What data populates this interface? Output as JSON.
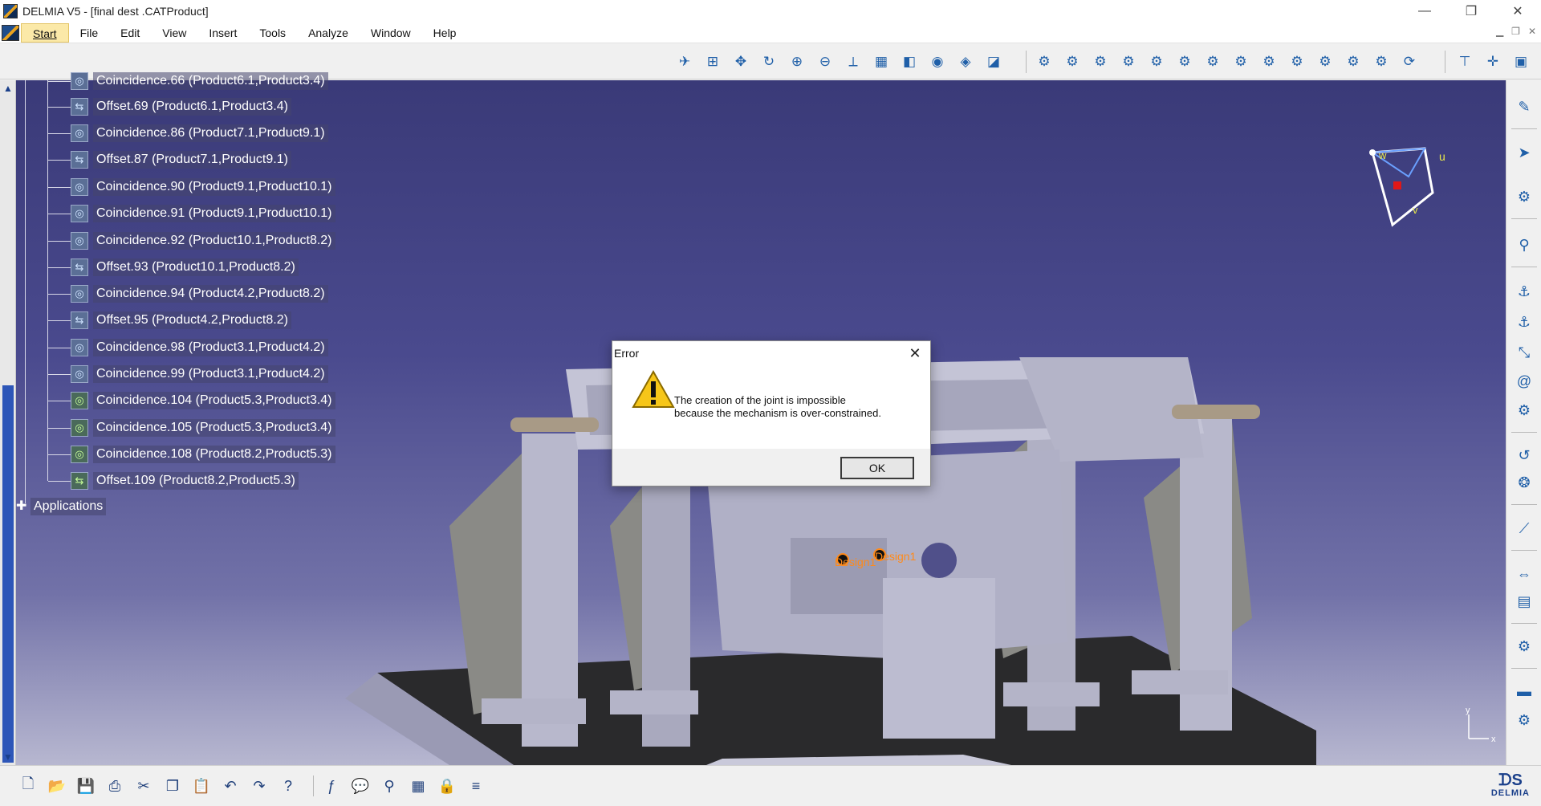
{
  "window": {
    "title": "DELMIA V5 - [final dest .CATProduct]",
    "minimize": "—",
    "restore": "❐",
    "close": "✕"
  },
  "menu": {
    "items": [
      {
        "label": "Start",
        "key": "start"
      },
      {
        "label": "File",
        "key": "file"
      },
      {
        "label": "Edit",
        "key": "edit"
      },
      {
        "label": "View",
        "key": "view"
      },
      {
        "label": "Insert",
        "key": "insert"
      },
      {
        "label": "Tools",
        "key": "tools"
      },
      {
        "label": "Analyze",
        "key": "analyze"
      },
      {
        "label": "Window",
        "key": "window"
      },
      {
        "label": "Help",
        "key": "help"
      }
    ]
  },
  "tree": {
    "partial_top": "Coincidence.66 (Product6.1,Product3.4)",
    "items": [
      {
        "label": "Offset.69 (Product6.1,Product3.4)",
        "icon": "offset-constraint-icon"
      },
      {
        "label": "Coincidence.86 (Product7.1,Product9.1)",
        "icon": "coincidence-constraint-icon"
      },
      {
        "label": "Offset.87 (Product7.1,Product9.1)",
        "icon": "offset-constraint-icon"
      },
      {
        "label": "Coincidence.90 (Product9.1,Product10.1)",
        "icon": "coincidence-constraint-icon"
      },
      {
        "label": "Coincidence.91 (Product9.1,Product10.1)",
        "icon": "coincidence-constraint-icon"
      },
      {
        "label": "Coincidence.92 (Product10.1,Product8.2)",
        "icon": "coincidence-constraint-icon"
      },
      {
        "label": "Offset.93 (Product10.1,Product8.2)",
        "icon": "offset-constraint-icon"
      },
      {
        "label": "Coincidence.94 (Product4.2,Product8.2)",
        "icon": "coincidence-constraint-icon"
      },
      {
        "label": "Offset.95 (Product4.2,Product8.2)",
        "icon": "offset-constraint-icon"
      },
      {
        "label": "Coincidence.98 (Product3.1,Product4.2)",
        "icon": "coincidence-constraint-icon"
      },
      {
        "label": "Coincidence.99 (Product3.1,Product4.2)",
        "icon": "coincidence-constraint-icon"
      },
      {
        "label": "Coincidence.104 (Product5.3,Product3.4)",
        "icon": "coincidence-constraint-icon"
      },
      {
        "label": "Coincidence.105 (Product5.3,Product3.4)",
        "icon": "coincidence-constraint-icon"
      },
      {
        "label": "Coincidence.108 (Product8.2,Product5.3)",
        "icon": "coincidence-constraint-icon"
      },
      {
        "label": "Offset.109 (Product8.2,Product5.3)",
        "icon": "offset-constraint-icon"
      }
    ],
    "applications": "Applications"
  },
  "compass": {
    "u": "u",
    "v": "v",
    "w": "w"
  },
  "axis": {
    "x": "x",
    "y": "y"
  },
  "scene": {
    "label1": "Design1",
    "label2": "Design1"
  },
  "dialog": {
    "title": "Error",
    "line1": "The creation of the joint is impossible",
    "line2": "because the mechanism is over-constrained.",
    "ok_label": "OK"
  },
  "brand": {
    "name": "DELMIA"
  },
  "colors": {
    "viewport_top": "#3a3a78",
    "viewport_bottom": "#b7b7d0",
    "scrollbar_thumb": "#2d56b8",
    "start_highlight": "#fbe9a8"
  }
}
